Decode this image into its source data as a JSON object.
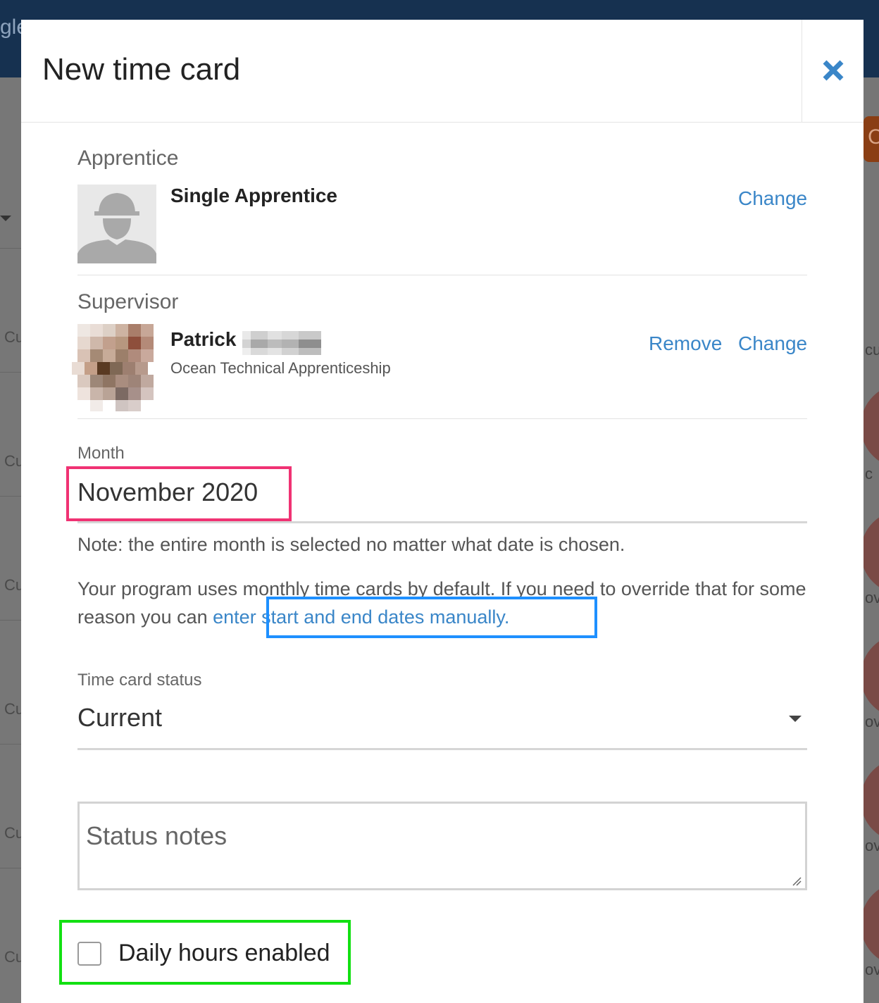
{
  "background": {
    "topbar_text": "gle",
    "left_row_text": "Cu",
    "right_column_texts": [
      "cu",
      "c",
      "ove",
      "ove",
      "ove",
      "ove"
    ]
  },
  "modal": {
    "title": "New time card",
    "close_icon": "close-icon"
  },
  "apprentice": {
    "section_label": "Apprentice",
    "name": "Single Apprentice",
    "change_label": "Change",
    "avatar_icon": "person-hardhat-icon"
  },
  "supervisor": {
    "section_label": "Supervisor",
    "first_name": "Patrick",
    "organization": "Ocean Technical Apprenticeship",
    "remove_label": "Remove",
    "change_label": "Change"
  },
  "month": {
    "label": "Month",
    "value": "November 2020",
    "note": "Note: the entire month is selected no matter what date is chosen.",
    "override_text": "Your program uses monthly time cards by default. If you need to override that for some reason you can",
    "override_link": "enter start and end dates manually."
  },
  "status": {
    "label": "Time card status",
    "value": "Current",
    "notes_placeholder": "Status notes"
  },
  "daily_hours": {
    "label": "Daily hours enabled",
    "checked": false
  },
  "colors": {
    "link": "#3a86c8",
    "highlight_month": "#f03273",
    "highlight_link": "#1e90ff",
    "highlight_checkbox": "#12e012",
    "topbar": "#163150"
  }
}
